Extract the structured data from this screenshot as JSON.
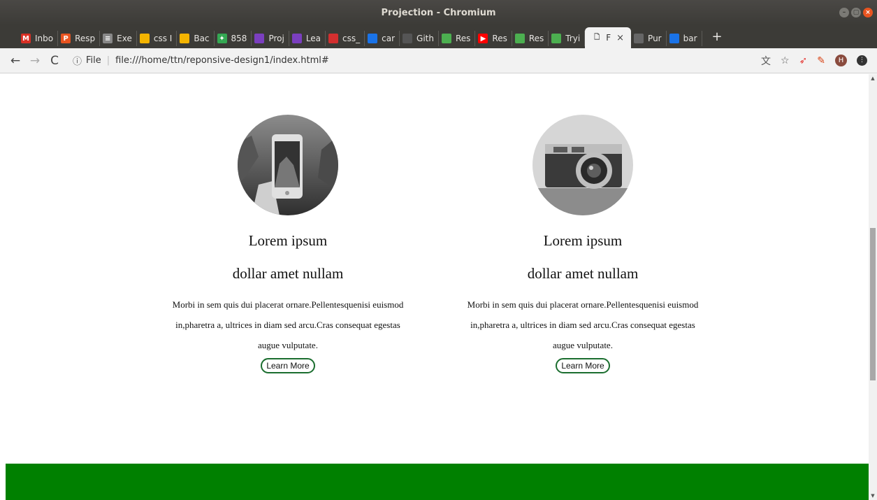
{
  "window": {
    "title": "Projection - Chromium"
  },
  "tabs": [
    {
      "label": "Inbo",
      "icon": "gmail-icon",
      "color": "#d93025",
      "glyph": "M"
    },
    {
      "label": "Resp",
      "icon": "pinterest-icon",
      "color": "#e95420",
      "glyph": "P"
    },
    {
      "label": "Exe",
      "icon": "list-icon",
      "color": "#888888",
      "glyph": "≡"
    },
    {
      "label": "css I",
      "icon": "slides-icon",
      "color": "#f4b400",
      "glyph": ""
    },
    {
      "label": "Bac",
      "icon": "slides-icon",
      "color": "#f4b400",
      "glyph": ""
    },
    {
      "label": "858",
      "icon": "pinwheel-icon",
      "color": "#34a853",
      "glyph": "✦"
    },
    {
      "label": "Proj",
      "icon": "globe-icon",
      "color": "#7b3fbf",
      "glyph": ""
    },
    {
      "label": "Lea",
      "icon": "globe-icon",
      "color": "#7b3fbf",
      "glyph": ""
    },
    {
      "label": "css_",
      "icon": "image-icon",
      "color": "#d32f2f",
      "glyph": ""
    },
    {
      "label": "car",
      "icon": "flag-icon",
      "color": "#1a73e8",
      "glyph": ""
    },
    {
      "label": "Gith",
      "icon": "github-icon",
      "color": "#555555",
      "glyph": ""
    },
    {
      "label": "Res",
      "icon": "w3-icon",
      "color": "#4caf50",
      "glyph": ""
    },
    {
      "label": "Res",
      "icon": "youtube-icon",
      "color": "#ff0000",
      "glyph": "▶"
    },
    {
      "label": "Res",
      "icon": "w3-icon",
      "color": "#4caf50",
      "glyph": ""
    },
    {
      "label": "Tryi",
      "icon": "w3-icon",
      "color": "#4caf50",
      "glyph": ""
    },
    {
      "label": "F",
      "icon": "document-icon",
      "active": true
    },
    {
      "label": "Pur",
      "icon": "globe-gray-icon",
      "color": "#666666",
      "glyph": ""
    },
    {
      "label": "bar",
      "icon": "flag-icon",
      "color": "#1a73e8",
      "glyph": ""
    }
  ],
  "toolbar": {
    "url_scheme": "File",
    "url": "file:///home/ttn/reponsive-design1/index.html#",
    "avatar_letter": "H"
  },
  "cards": [
    {
      "title": "Lorem ipsum",
      "subtitle": "dollar amet nullam",
      "body": "Morbi in sem quis dui placerat ornare.Pellentesquenisi euismod in,pharetra a, ultrices in diam sed arcu.Cras consequat egestas augue vulputate.",
      "button": "Learn More",
      "image": "phone-photo"
    },
    {
      "title": "Lorem ipsum",
      "subtitle": "dollar amet nullam",
      "body": "Morbi in sem quis dui placerat ornare.Pellentesquenisi euismod in,pharetra a, ultrices in diam sed arcu.Cras consequat egestas augue vulputate.",
      "button": "Learn More",
      "image": "camera-photo"
    }
  ],
  "colors": {
    "footer": "#008000",
    "button_border": "#1b6e2f",
    "titlebar": "#3c3b37"
  }
}
